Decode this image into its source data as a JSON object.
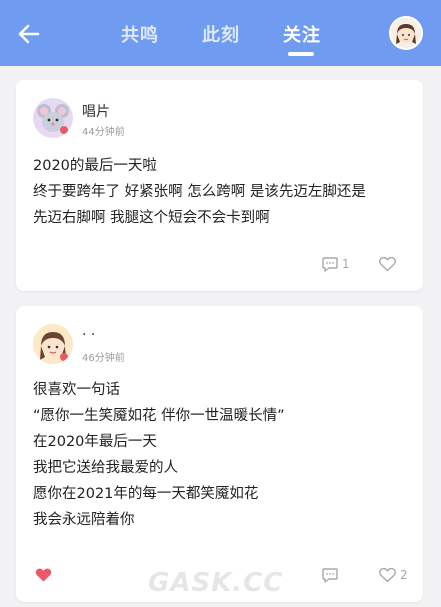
{
  "header": {
    "tabs": [
      {
        "label": "共鸣"
      },
      {
        "label": "此刻"
      },
      {
        "label": "关注"
      }
    ]
  },
  "posts": [
    {
      "author": "唱片",
      "time": "44分钟前",
      "lines": [
        "2020的最后一天啦",
        "终于要跨年了 好紧张啊 怎么跨啊 是该先迈左脚还是",
        "先迈右脚啊 我腿这个短会不会卡到啊"
      ],
      "comments": "1",
      "likes": ""
    },
    {
      "author": "· ·",
      "time": "46分钟前",
      "lines": [
        "很喜欢一句话",
        "“愿你一生笑魇如花 伴你一世温暖长情”",
        "在2020年最后一天",
        "我把它送给我最爱的人",
        "愿你在2021年的每一天都笑魇如花",
        "我会永远陪着你"
      ],
      "comments": "",
      "likes": "2"
    }
  ],
  "watermark": "GASK.CC",
  "colors": {
    "header_bg": "#6f9bf0",
    "accent_heart": "#e8596a"
  }
}
